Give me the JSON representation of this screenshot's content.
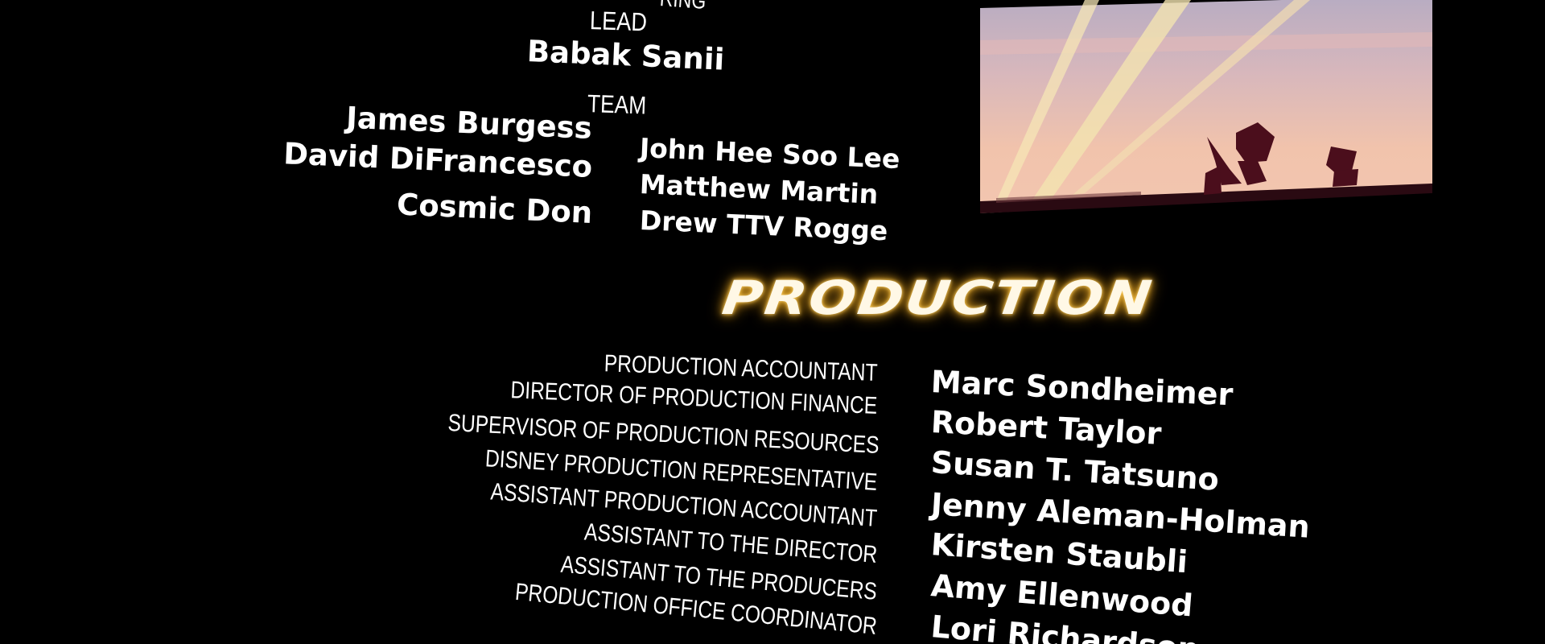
{
  "upper_section": {
    "partial_top_label": "RING",
    "lead_label": "LEAD",
    "lead_name": "Babak Sanii",
    "team_label": "TEAM",
    "team_left": [
      "James Burgess",
      "David DiFrancesco",
      "Cosmic Don"
    ],
    "team_right": [
      "John Hee Soo Lee",
      "Matthew Martin",
      "Drew TTV Rogge"
    ]
  },
  "production": {
    "heading": "PRODUCTION",
    "roles": [
      "PRODUCTION ACCOUNTANT",
      "DIRECTOR OF PRODUCTION FINANCE",
      "SUPERVISOR OF PRODUCTION RESOURCES",
      "DISNEY PRODUCTION REPRESENTATIVE",
      "ASSISTANT PRODUCTION ACCOUNTANT",
      "ASSISTANT TO THE DIRECTOR",
      "ASSISTANT TO THE PRODUCERS",
      "PRODUCTION OFFICE COORDINATOR"
    ],
    "names": [
      "Marc Sondheimer",
      "Robert Taylor",
      "Susan T. Tatsuno",
      "Jenny Aleman-Holman",
      "Kirsten Staubli",
      "Amy Ellenwood",
      "Lori Richardson"
    ]
  },
  "colors": {
    "background": "#000000",
    "text": "#ffffff",
    "heading_glow": "#e8a924",
    "sky_top": "#b7acc2",
    "sky_bottom": "#f1c3ac",
    "silhouette": "#4b0e1c"
  }
}
